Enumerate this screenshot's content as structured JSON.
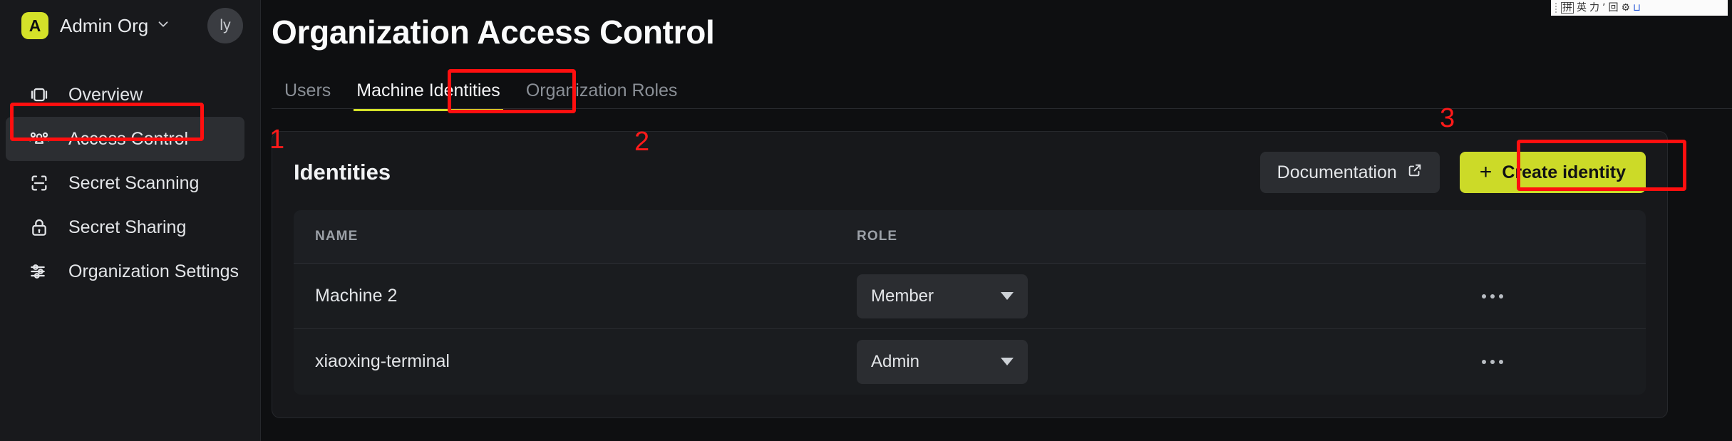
{
  "sidebar": {
    "org": {
      "badge_letter": "A",
      "name": "Admin Org",
      "caret_icon": "chevron-down-icon",
      "badge_color": "#d4e129"
    },
    "avatar_initials": "ly",
    "items": [
      {
        "label": "Overview",
        "icon": "layers-icon",
        "active": false
      },
      {
        "label": "Access Control",
        "icon": "users-group-icon",
        "active": true
      },
      {
        "label": "Secret Scanning",
        "icon": "scan-frame-icon",
        "active": false
      },
      {
        "label": "Secret Sharing",
        "icon": "lock-icon",
        "active": false
      },
      {
        "label": "Organization Settings",
        "icon": "sliders-icon",
        "active": false
      }
    ]
  },
  "main": {
    "page_title": "Organization Access Control",
    "tabs": [
      {
        "label": "Users",
        "active": false
      },
      {
        "label": "Machine Identities",
        "active": true
      },
      {
        "label": "Organization Roles",
        "active": false
      }
    ],
    "card": {
      "title": "Identities",
      "documentation_button": {
        "label": "Documentation",
        "icon": "external-link-icon"
      },
      "create_button": {
        "label": "Create identity",
        "icon": "plus-icon",
        "color": "#ccda28"
      },
      "table": {
        "columns": [
          "NAME",
          "ROLE",
          ""
        ],
        "rows": [
          {
            "name": "Machine 2",
            "role": "Member",
            "actions_icon": "ellipsis-icon"
          },
          {
            "name": "xiaoxing-terminal",
            "role": "Admin",
            "actions_icon": "ellipsis-icon"
          }
        ]
      }
    }
  },
  "annotations": {
    "color": "#ff1a1a",
    "markers": [
      {
        "number": "1",
        "target": "sidebar-item-access-control"
      },
      {
        "number": "2",
        "target": "tab-machine-identities"
      },
      {
        "number": "3",
        "target": "create-identity-button"
      }
    ]
  },
  "ime_toolbar": {
    "icons": [
      "pinyin-mode-icon",
      "chinese-english-icon",
      "traditional-icon",
      "punctuation-icon",
      "soft-keyboard-icon",
      "settings-gear-icon",
      "toolbox-icon"
    ],
    "glyphs": [
      "拼",
      "英",
      "力",
      "ʼ",
      "回",
      "⚙",
      "⊔"
    ]
  }
}
